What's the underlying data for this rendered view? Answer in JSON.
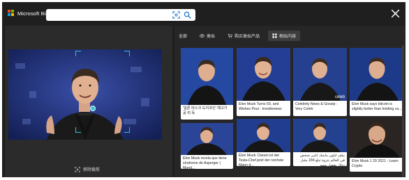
{
  "header": {
    "brand": "Microsoft Bing",
    "search_placeholder": "",
    "logo_colors": [
      "#f25022",
      "#7fba00",
      "#00a4ef",
      "#ffb900"
    ],
    "icons": {
      "visual_search": "visual-search-icon",
      "search": "search-icon",
      "close": "close-icon"
    }
  },
  "left": {
    "remove_crop_label": "移除裁剪",
    "accent": "#36c2d4"
  },
  "tabs": [
    {
      "label": "全部",
      "icon": null,
      "active": false
    },
    {
      "label": "类似",
      "icon": "eye-icon",
      "active": false
    },
    {
      "label": "购买类似产品",
      "icon": "cart-icon",
      "active": false
    },
    {
      "label": "相似内容",
      "icon": "grid-icon",
      "active": true
    }
  ],
  "results": [
    {
      "caption": "'일론 머스크 도지코인' 예고가 공 럭 독"
    },
    {
      "caption": "Elon Musk Turns 50, and Wishes Pour : trendienewz"
    },
    {
      "caption": "Celebrity News & Gossip : Very Celeb",
      "badge": "celeb"
    },
    {
      "caption": "Elon Musk says bitcoin is slightly better than holding ca..."
    },
    {
      "caption": "Elon Musk revela que tiene síndrome de Asperger | Mund..."
    },
    {
      "caption": "Elon Musk: Darum ist der Tesla-Chef jetzt der reichste Mann d..."
    },
    {
      "caption": "بيلف ايلون ماسك اغنى شخص في العالم بثروة تبلغ 184 مليار دولار بفضل سهم"
    },
    {
      "caption": "Elon Musk 1 29 2021 - Learn Crypto"
    }
  ]
}
